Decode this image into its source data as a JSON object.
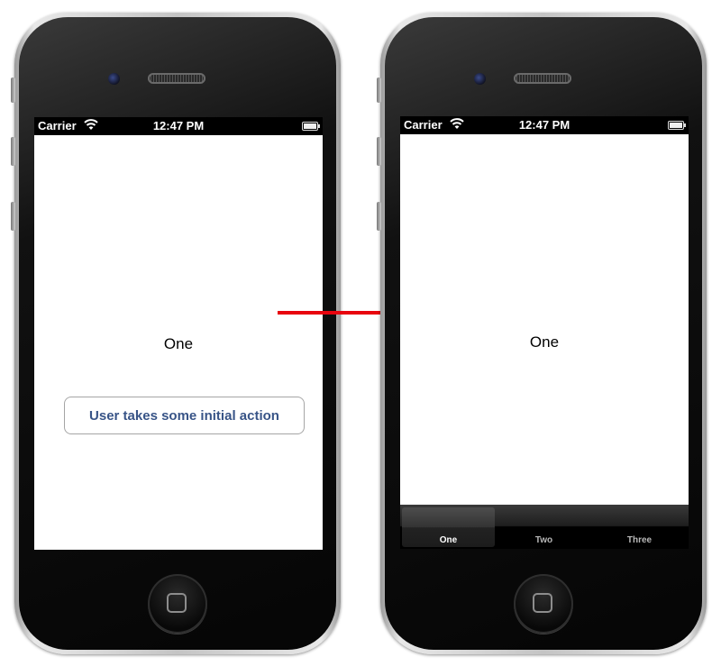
{
  "colors": {
    "arrow": "#e8040e",
    "button_text": "#385487"
  },
  "left_phone": {
    "status_bar": {
      "carrier": "Carrier",
      "wifi_icon": "wifi-icon",
      "time": "12:47 PM",
      "battery_icon": "battery-icon"
    },
    "screen": {
      "label": "One",
      "action_button": "User takes some initial action"
    }
  },
  "transition_arrow_icon": "right-arrow-icon",
  "right_phone": {
    "status_bar": {
      "carrier": "Carrier",
      "wifi_icon": "wifi-icon",
      "time": "12:47 PM",
      "battery_icon": "battery-icon"
    },
    "screen": {
      "label": "One"
    },
    "tab_bar": {
      "tabs": [
        {
          "label": "One",
          "selected": true
        },
        {
          "label": "Two",
          "selected": false
        },
        {
          "label": "Three",
          "selected": false
        }
      ]
    }
  }
}
